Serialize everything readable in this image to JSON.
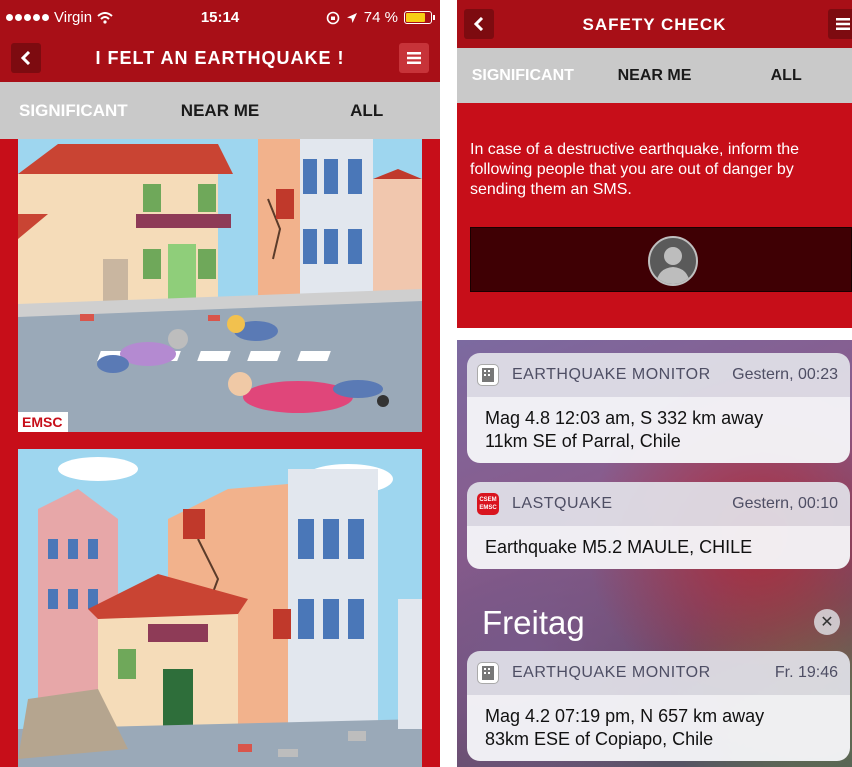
{
  "left": {
    "status_bar": {
      "carrier": "Virgin",
      "time": "15:14",
      "battery_percent": "74 %",
      "battery_level": 0.74
    },
    "header": {
      "title": "I FELT AN EARTHQUAKE !",
      "back_icon": "chevron-left-icon",
      "menu_icon": "menu-icon"
    },
    "tabs": [
      {
        "label": "SIGNIFICANT",
        "active": true
      },
      {
        "label": "NEAR ME",
        "active": false
      },
      {
        "label": "ALL",
        "active": false
      }
    ],
    "illustrations": [
      {
        "badge": "EMSC"
      }
    ]
  },
  "safety": {
    "header": {
      "title": "SAFETY CHECK",
      "back_icon": "chevron-left-icon",
      "menu_icon": "menu-icon"
    },
    "tabs": [
      {
        "label": "SIGNIFICANT",
        "active": true
      },
      {
        "label": "NEAR ME",
        "active": false
      },
      {
        "label": "ALL",
        "active": false
      }
    ],
    "message": "In case of a destructive earthquake, inform the following people that you are out of danger by sending them an SMS."
  },
  "lock": {
    "notifications": [
      {
        "app": "EARTHQUAKE MONITOR",
        "time": "Gestern, 00:23",
        "line1": "Mag 4.8 12:03 am, S 332 km away",
        "line2": "11km SE of Parral, Chile"
      },
      {
        "app": "LASTQUAKE",
        "time": "Gestern, 00:10",
        "line1": "Earthquake M5.2 MAULE, CHILE",
        "icon_text_1": "CSEM",
        "icon_text_2": "EMSC"
      },
      {
        "app": "EARTHQUAKE MONITOR",
        "time": "Fr. 19:46",
        "line1": "Mag 4.2 07:19 pm, N 657 km away",
        "line2": "83km ESE of Copiapo, Chile"
      }
    ],
    "section_label": "Freitag"
  },
  "colors": {
    "primary_red": "#c70e19",
    "dark_red": "#a80f17",
    "tab_gray": "#c9c9c9",
    "battery_yellow": "#f7cf14"
  }
}
